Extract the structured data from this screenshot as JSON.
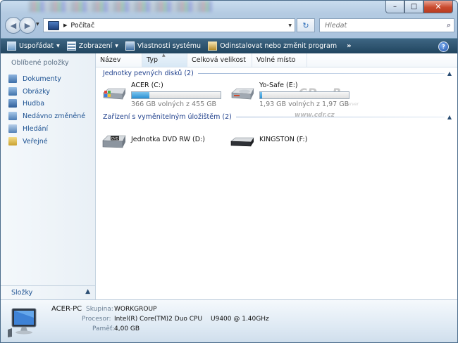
{
  "window": {
    "minimize_glyph": "–",
    "maximize_glyph": "□",
    "close_glyph": "✕"
  },
  "address": {
    "crumb": "Počítač",
    "refresh_icon": "refresh-icon",
    "search_placeholder": "Hledat"
  },
  "toolbar": {
    "organize": "Uspořádat",
    "views": "Zobrazení",
    "system_properties": "Vlastnosti systému",
    "uninstall": "Odinstalovat nebo změnit program",
    "more": "»",
    "help": "?"
  },
  "sidebar": {
    "heading": "Oblíbené položky",
    "items": [
      {
        "label": "Dokumenty",
        "icon": "documents-icon"
      },
      {
        "label": "Obrázky",
        "icon": "pictures-icon"
      },
      {
        "label": "Hudba",
        "icon": "music-icon"
      },
      {
        "label": "Nedávno změněné",
        "icon": "recent-icon"
      },
      {
        "label": "Hledání",
        "icon": "search-folder-icon"
      },
      {
        "label": "Veřejné",
        "icon": "public-icon"
      }
    ],
    "folders_label": "Složky"
  },
  "columns": [
    "Název",
    "Typ",
    "Celková velikost",
    "Volné místo"
  ],
  "groups": {
    "hard_drives": {
      "title": "Jednotky pevných disků (2)",
      "drives": [
        {
          "name": "ACER (C:)",
          "free": "366 GB volných z 455 GB",
          "used_fraction": 0.2
        },
        {
          "name": "Yo-Safe (E:)",
          "free": "1,93 GB volných z 1,97 GB",
          "used_fraction": 0.02
        }
      ]
    },
    "removable": {
      "title": "Zařízení s vyměnitelným úložištěm (2)",
      "devices": [
        {
          "name": "Jednotka DVD RW (D:)",
          "icon": "dvd-drive-icon",
          "badge": "DVD"
        },
        {
          "name": "KINGSTON (F:)",
          "icon": "usb-drive-icon"
        }
      ]
    }
  },
  "watermark": {
    "main": "CD - R",
    "small": "server",
    "url": "www.cdr.cz"
  },
  "details": {
    "computer_name": "ACER-PC",
    "workgroup_label": "Skupina:",
    "workgroup_value": "WORKGROUP",
    "processor_label": "Procesor:",
    "processor_value": "Intel(R) Core(TM)2 Duo CPU",
    "processor_model": "U9400  @ 1.40GHz",
    "memory_label": "Paměť:",
    "memory_value": "4,00 GB"
  },
  "colors": {
    "toolbar": "#2c516d",
    "link": "#1c5191",
    "group_title": "#1e3f8c",
    "progress": "#2a8fd2"
  }
}
